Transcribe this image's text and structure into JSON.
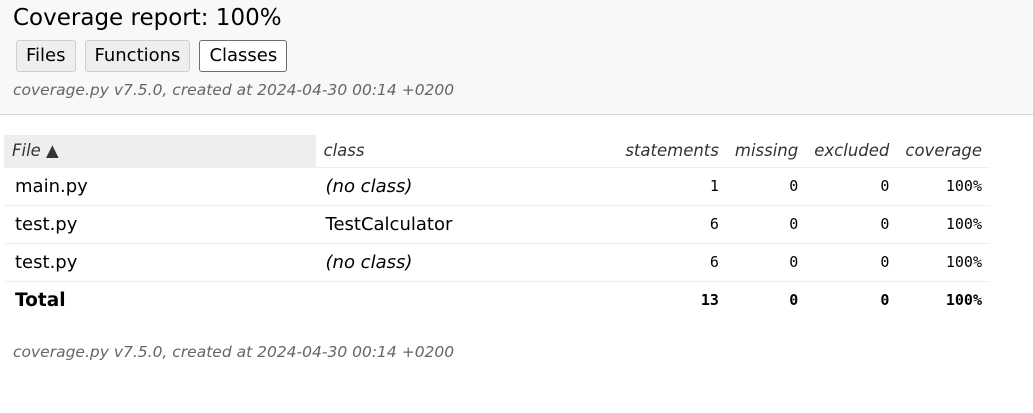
{
  "header": {
    "title": "Coverage report: 100%",
    "tabs": [
      {
        "label": "Files"
      },
      {
        "label": "Functions"
      },
      {
        "label": "Classes"
      }
    ],
    "meta": "coverage.py v7.5.0, created at 2024-04-30 00:14 +0200"
  },
  "table": {
    "columns": {
      "file": "File ▲",
      "class": "class",
      "statements": "statements",
      "missing": "missing",
      "excluded": "excluded",
      "coverage": "coverage"
    },
    "rows": [
      {
        "file": "main.py",
        "class": "(no class)",
        "statements": "1",
        "missing": "0",
        "excluded": "0",
        "coverage": "100%"
      },
      {
        "file": "test.py",
        "class": "TestCalculator",
        "statements": "6",
        "missing": "0",
        "excluded": "0",
        "coverage": "100%"
      },
      {
        "file": "test.py",
        "class": "(no class)",
        "statements": "6",
        "missing": "0",
        "excluded": "0",
        "coverage": "100%"
      }
    ],
    "total": {
      "label": "Total",
      "statements": "13",
      "missing": "0",
      "excluded": "0",
      "coverage": "100%"
    }
  },
  "footer": "coverage.py v7.5.0, created at 2024-04-30 00:14 +0200"
}
